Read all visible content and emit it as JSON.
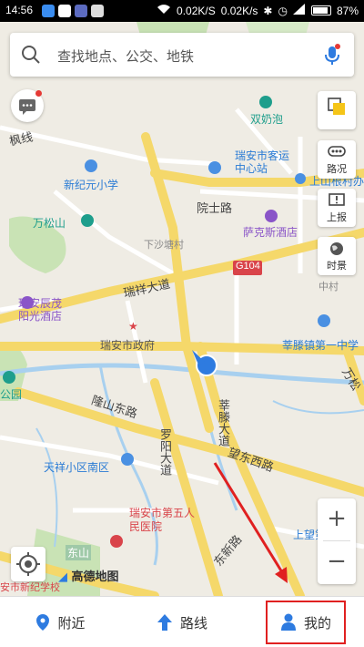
{
  "status_bar": {
    "time": "14:56",
    "net_speed_1": "0.02K/S",
    "net_speed_2": "0.02K/s",
    "battery": "87%",
    "battery_level": 0.87
  },
  "search": {
    "placeholder": "查找地点、公交、地铁",
    "search_icon": "search-icon",
    "mic_icon": "microphone-icon"
  },
  "map": {
    "roads": {
      "r1": "瑞祥大道",
      "r2": "隆山东路",
      "r3": "罗阳大道",
      "r4": "望东西路",
      "r5": "院士路",
      "r6": "莘滕大道",
      "r7": "东新路",
      "r8": "万松",
      "r9": "东山",
      "r10": "G104"
    },
    "places": {
      "p1": "双奶泡",
      "p2": "瑞安市客运中心站",
      "p3": "新纪元小学",
      "p4": "上山根村办",
      "p5": "万松山",
      "p6": "下沙塘村",
      "p7": "萨克斯酒店",
      "p8": "中村",
      "p9": "瑞安辰茂阳光酒店",
      "p10": "瑞安市政府",
      "p11": "莘滕镇第一中学",
      "p12": "公园",
      "p13": "天祥小区南区",
      "p14": "瑞安市第五人民医院",
      "p15": "上望第一",
      "p16": "高德地图",
      "p17": "安市新纪学校"
    }
  },
  "tools": {
    "layers": "图层",
    "traffic": "路况",
    "report": "上报",
    "timeview": "时景"
  },
  "zoom": {
    "in": "+",
    "out": "−"
  },
  "bottom_nav": {
    "nearby": "附近",
    "route": "路线",
    "mine": "我的"
  },
  "colors": {
    "accent": "#2e7be0",
    "highlight": "#e02020",
    "road_yellow": "#f5d86a",
    "water": "#a8d0ef"
  }
}
